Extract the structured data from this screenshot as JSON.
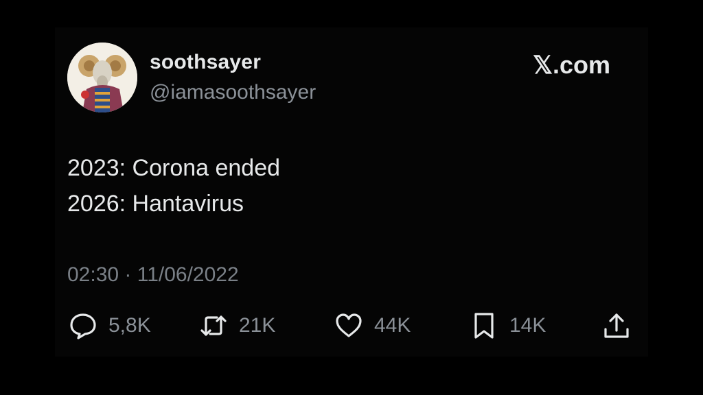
{
  "author": {
    "name": "soothsayer",
    "handle": "@iamasoothsayer"
  },
  "brand": "𝕏.com",
  "tweet": {
    "lines": [
      "2023: Corona ended",
      "2026: Hantavirus"
    ]
  },
  "timestamp": "02:30 · 11/06/2022",
  "actions": {
    "reply": {
      "icon": "reply-icon",
      "count": "5,8K"
    },
    "retweet": {
      "icon": "retweet-icon",
      "count": "21K"
    },
    "like": {
      "icon": "heart-icon",
      "count": "44K"
    },
    "bookmark": {
      "icon": "bookmark-icon",
      "count": "14K"
    },
    "share": {
      "icon": "share-icon"
    }
  },
  "colors": {
    "background": "#000000",
    "text": "#e7e9ea",
    "muted": "#8b9198"
  }
}
